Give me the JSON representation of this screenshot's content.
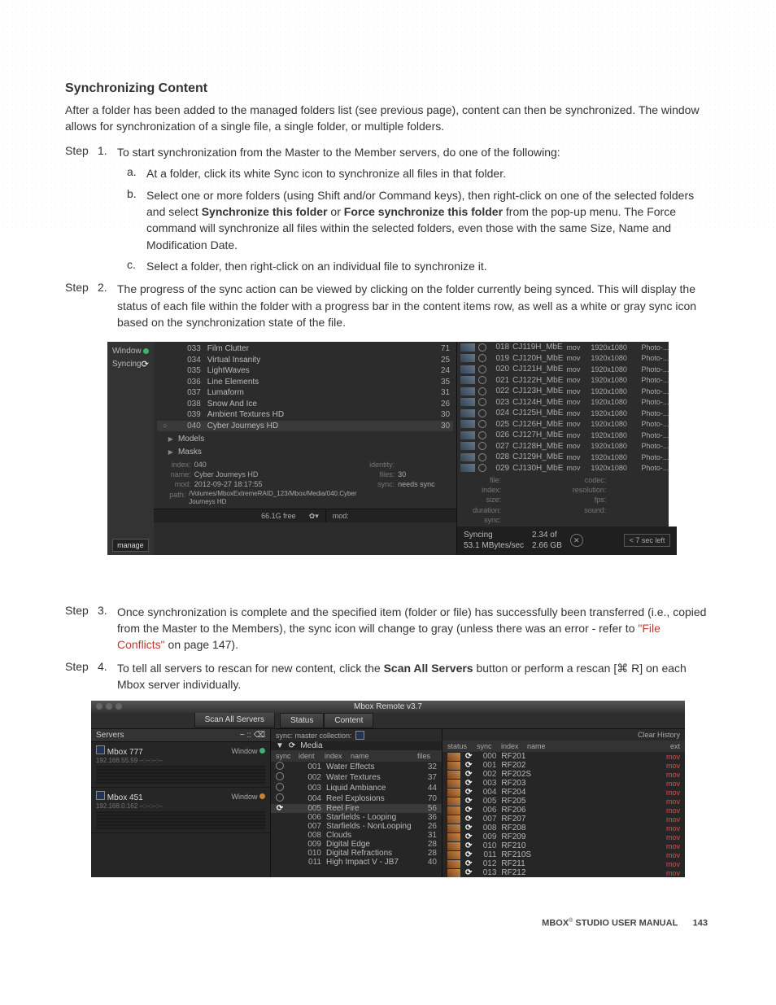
{
  "heading": "Synchronizing Content",
  "intro": "After a folder has been added to the managed folders list (see previous page), content can then be synchronized. The window allows for synchronization of a single file, a single folder, or multiple folders.",
  "steps": {
    "s1": {
      "label": "Step",
      "num": "1.",
      "text": "To start synchronization from the Master to the Member servers, do one of the following:",
      "a_label": "a.",
      "a_text": "At a folder, click its white Sync icon to synchronize all files in that folder.",
      "b_label": "b.",
      "b_pre": "Select one or more folders (using Shift and/or Command keys), then right-click on one of the selected folders and select ",
      "b_bold1": "Synchronize this folder",
      "b_or": " or ",
      "b_bold2": "Force synchronize this folder",
      "b_post": " from the pop-up menu. The Force command will synchronize all files within the selected folders, even those with the same Size, Name and Modification Date.",
      "c_label": "c.",
      "c_text": "Select a folder, then right-click on an individual file to synchronize it."
    },
    "s2": {
      "label": "Step",
      "num": "2.",
      "text": "The progress of the sync action can be viewed by clicking on the folder currently being synced. This will display the status of each file within the folder with a progress bar in the content items row, as well as a white or gray sync icon based on the synchronization state of the file."
    },
    "s3": {
      "label": "Step",
      "num": "3.",
      "pre": "Once synchronization is complete and the specified item (folder or file) has successfully been transferred (i.e., copied from the Master to the Members), the sync icon will change to gray (unless there was an error - refer to ",
      "link": "\"File Conflicts\"",
      "post": " on page 147)."
    },
    "s4": {
      "label": "Step",
      "num": "4.",
      "pre": "To tell all servers to rescan for new content, click the ",
      "bold": "Scan All Servers",
      "post": " button or perform a rescan [⌘ R] on each Mbox server individually."
    }
  },
  "shot1": {
    "left": {
      "window": "Window",
      "syncing": "Syncing",
      "manage": "manage"
    },
    "folders": [
      {
        "idx": "033",
        "name": "Film Clutter",
        "files": "71"
      },
      {
        "idx": "034",
        "name": "Virtual Insanity",
        "files": "25"
      },
      {
        "idx": "035",
        "name": "LightWaves",
        "files": "24"
      },
      {
        "idx": "036",
        "name": "Line Elements",
        "files": "35"
      },
      {
        "idx": "037",
        "name": "Lumaform",
        "files": "31"
      },
      {
        "idx": "038",
        "name": "Snow And Ice",
        "files": "26"
      },
      {
        "idx": "039",
        "name": "Ambient Textures HD",
        "files": "30"
      },
      {
        "idx": "040",
        "name": "Cyber Journeys HD",
        "files": "30"
      }
    ],
    "disclosures": {
      "models": "Models",
      "masks": "Masks"
    },
    "meta": {
      "index_l": "index:",
      "index_v": "040",
      "name_l": "name:",
      "name_v": "Cyber Journeys HD",
      "mod_l": "mod:",
      "mod_v": "2012-09-27 18:17:55",
      "path_l": "path:",
      "path_v": "/Volumes/MboxExtremeRAID_123/Mbox/Media/040.Cyber Journeys HD",
      "identity_l": "identity:",
      "files_l": "files:",
      "files_v": "30",
      "sync_l": "sync:",
      "sync_v": "needs sync"
    },
    "footer": {
      "free": "66.1G free",
      "gear": "✿▾",
      "mod": "mod:"
    },
    "files": [
      {
        "idx": "018",
        "name": "CJ119H_MbE",
        "ext": "mov",
        "res": "1920x1080",
        "kind": "Photo-..."
      },
      {
        "idx": "019",
        "name": "CJ120H_MbE",
        "ext": "mov",
        "res": "1920x1080",
        "kind": "Photo-..."
      },
      {
        "idx": "020",
        "name": "CJ121H_MbE",
        "ext": "mov",
        "res": "1920x1080",
        "kind": "Photo-..."
      },
      {
        "idx": "021",
        "name": "CJ122H_MbE",
        "ext": "mov",
        "res": "1920x1080",
        "kind": "Photo-..."
      },
      {
        "idx": "022",
        "name": "CJ123H_MbE",
        "ext": "mov",
        "res": "1920x1080",
        "kind": "Photo-..."
      },
      {
        "idx": "023",
        "name": "CJ124H_MbE",
        "ext": "mov",
        "res": "1920x1080",
        "kind": "Photo-..."
      },
      {
        "idx": "024",
        "name": "CJ125H_MbE",
        "ext": "mov",
        "res": "1920x1080",
        "kind": "Photo-..."
      },
      {
        "idx": "025",
        "name": "CJ126H_MbE",
        "ext": "mov",
        "res": "1920x1080",
        "kind": "Photo-..."
      },
      {
        "idx": "026",
        "name": "CJ127H_MbE",
        "ext": "mov",
        "res": "1920x1080",
        "kind": "Photo-..."
      },
      {
        "idx": "027",
        "name": "CJ128H_MbE",
        "ext": "mov",
        "res": "1920x1080",
        "kind": "Photo-..."
      },
      {
        "idx": "028",
        "name": "CJ129H_MbE",
        "ext": "mov",
        "res": "1920x1080",
        "kind": "Photo-..."
      },
      {
        "idx": "029",
        "name": "CJ130H_MbE",
        "ext": "mov",
        "res": "1920x1080",
        "kind": "Photo-..."
      }
    ],
    "meta2": {
      "file_l": "file:",
      "index_l": "index:",
      "size_l": "size:",
      "duration_l": "duration:",
      "sync_l": "sync:",
      "codec_l": "codec:",
      "resolution_l": "resolution:",
      "fps_l": "fps:",
      "sound_l": "sound:"
    },
    "syncbar": {
      "line1": "Syncing",
      "line2": "53.1 MBytes/sec",
      "prog1": "2.34 of",
      "prog2": "2.66 GB",
      "eta": "< 7 sec left"
    }
  },
  "shot2": {
    "title": "Mbox Remote v3.7",
    "toolbar": {
      "scan": "Scan All Servers",
      "status": "Status",
      "content": "Content"
    },
    "servers_hdr": "Servers",
    "servers_icons": "−  ::  ⌫",
    "clear": "Clear History",
    "sync_master": "sync: master collection:",
    "media_hdr": "Media",
    "servers": [
      {
        "name": "Mbox 777",
        "role": "Window",
        "sub": "192.168.55.59  --:--:--:--"
      },
      {
        "name": "Mbox 451",
        "role": "Window",
        "sub": "192.168.0.162  --:--:--:--"
      }
    ],
    "left_hdr": {
      "c1": "sync",
      "c2": "ident",
      "c3": "index",
      "c4": "name",
      "c5": "files"
    },
    "left_rows": [
      {
        "sync": "open",
        "idx": "001",
        "name": "Water Effects",
        "files": "32"
      },
      {
        "sync": "open",
        "idx": "002",
        "name": "Water Textures",
        "files": "37"
      },
      {
        "sync": "open",
        "idx": "003",
        "name": "Liquid Ambiance",
        "files": "44"
      },
      {
        "sync": "open",
        "idx": "004",
        "name": "Reel Explosions",
        "files": "70"
      },
      {
        "sync": "black",
        "idx": "005",
        "name": "Reel Fire",
        "files": "56"
      },
      {
        "sync": "",
        "idx": "006",
        "name": "Starfields - Looping",
        "files": "36"
      },
      {
        "sync": "",
        "idx": "007",
        "name": "Starfields - NonLooping",
        "files": "26"
      },
      {
        "sync": "",
        "idx": "008",
        "name": "Clouds",
        "files": "31"
      },
      {
        "sync": "",
        "idx": "009",
        "name": "Digital Edge",
        "files": "28"
      },
      {
        "sync": "",
        "idx": "010",
        "name": "Digital Refractions",
        "files": "28"
      },
      {
        "sync": "",
        "idx": "011",
        "name": "High Impact V - JB7",
        "files": "40"
      }
    ],
    "right_hdr": {
      "c1": "status",
      "c2": "sync",
      "c3": "index",
      "c4": "name",
      "c5": "ext"
    },
    "right_rows": [
      {
        "idx": "000",
        "name": "RF201",
        "ext": "mov"
      },
      {
        "idx": "001",
        "name": "RF202",
        "ext": "mov"
      },
      {
        "idx": "002",
        "name": "RF202S",
        "ext": "mov"
      },
      {
        "idx": "003",
        "name": "RF203",
        "ext": "mov"
      },
      {
        "idx": "004",
        "name": "RF204",
        "ext": "mov"
      },
      {
        "idx": "005",
        "name": "RF205",
        "ext": "mov"
      },
      {
        "idx": "006",
        "name": "RF206",
        "ext": "mov"
      },
      {
        "idx": "007",
        "name": "RF207",
        "ext": "mov"
      },
      {
        "idx": "008",
        "name": "RF208",
        "ext": "mov"
      },
      {
        "idx": "009",
        "name": "RF209",
        "ext": "mov"
      },
      {
        "idx": "010",
        "name": "RF210",
        "ext": "mov"
      },
      {
        "idx": "011",
        "name": "RF210S",
        "ext": "mov"
      },
      {
        "idx": "012",
        "name": "RF211",
        "ext": "mov"
      },
      {
        "idx": "013",
        "name": "RF212",
        "ext": "mov"
      }
    ]
  },
  "footer": {
    "brand": "MBOX",
    "reg": "®",
    "rest": " STUDIO USER MANUAL",
    "page": "143"
  }
}
